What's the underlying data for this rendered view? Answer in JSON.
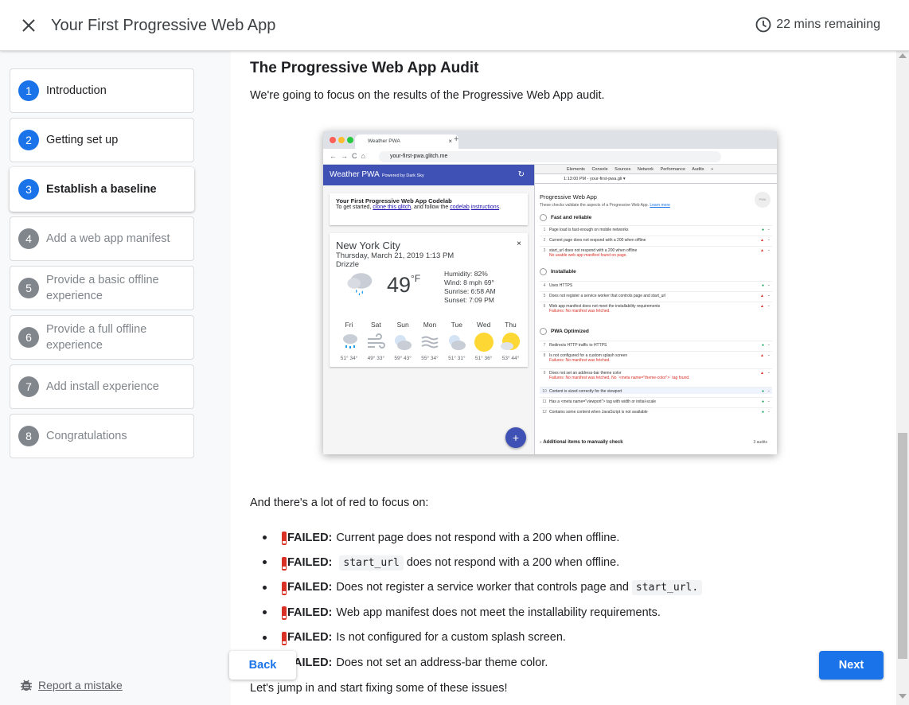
{
  "header": {
    "title": "Your First Progressive Web App",
    "time_remaining": "22 mins remaining"
  },
  "sidebar": {
    "steps": [
      {
        "num": "1",
        "label": "Introduction"
      },
      {
        "num": "2",
        "label": "Getting set up"
      },
      {
        "num": "3",
        "label": "Establish a baseline"
      },
      {
        "num": "4",
        "label": "Add a web app manifest"
      },
      {
        "num": "5",
        "label": "Provide a basic offline experience"
      },
      {
        "num": "6",
        "label": "Provide a full offline experience"
      },
      {
        "num": "7",
        "label": "Add install experience"
      },
      {
        "num": "8",
        "label": "Congratulations"
      }
    ],
    "current_step": 3,
    "report_label": "Report a mistake"
  },
  "content": {
    "title": "The Progressive Web App Audit",
    "intro": "We're going to focus on the results of the Progressive Web App audit.",
    "red_intro": "And there's a lot of red to focus on:",
    "failed_label": "FAILED:",
    "failures": [
      {
        "before": "Current page does not respond with a 200 when offline.",
        "code": "",
        "after": ""
      },
      {
        "before": "",
        "code": "start_url",
        "after": "does not respond with a 200 when offline."
      },
      {
        "before": "Does not register a service worker that controls page and",
        "code": "start_url.",
        "after": ""
      },
      {
        "before": "Web app manifest does not meet the installability requirements.",
        "code": "",
        "after": ""
      },
      {
        "before": "Is not configured for a custom splash screen.",
        "code": "",
        "after": ""
      },
      {
        "before": "Does not set an address-bar theme color.",
        "code": "",
        "after": ""
      }
    ],
    "outro": "Let's jump in and start fixing some of these issues!"
  },
  "screenshot": {
    "tab_title": "Weather PWA",
    "url": "your-first-pwa.glitch.me",
    "app_title": "Weather PWA",
    "powered_by": "Powered by Dark Sky",
    "codelab_title": "Your First Progressive Web App Codelab",
    "codelab_text_1": "To get started,",
    "codelab_link_1": "clone this glitch",
    "codelab_text_2": ", and follow the",
    "codelab_link_2": "codelab",
    "codelab_link_3": "instructions",
    "city": "New York City",
    "date": "Thursday, March 21, 2019 1:13 PM",
    "description": "Drizzle",
    "temperature": "49",
    "temp_unit": "°F",
    "humidity": "Humidity: 82%",
    "wind": "Wind: 8 mph 69°",
    "sunrise": "Sunrise: 6:58 AM",
    "sunset": "Sunset: 7:09 PM",
    "forecast": [
      {
        "day": "Fri",
        "temps": "51° 34°",
        "icon": "rain-icon"
      },
      {
        "day": "Sat",
        "temps": "49° 33°",
        "icon": "wind-icon"
      },
      {
        "day": "Sun",
        "temps": "59° 43°",
        "icon": "partly-cloudy-night-icon"
      },
      {
        "day": "Mon",
        "temps": "55° 34°",
        "icon": "fog-icon"
      },
      {
        "day": "Tue",
        "temps": "51° 31°",
        "icon": "partly-cloudy-night-icon"
      },
      {
        "day": "Wed",
        "temps": "51° 36°",
        "icon": "sun-icon"
      },
      {
        "day": "Thu",
        "temps": "53° 44°",
        "icon": "partly-cloudy-day-icon"
      }
    ],
    "devtools_tabs": "Elements Console Sources Network Performance Audits »",
    "devtools_sub": "1:13:00 PM - your-first-pwa.gli ▾",
    "audit_title": "Progressive Web App",
    "audit_subtitle": "These checks validate the aspects of a Progressive Web App.",
    "audit_learn_more": "Learn more",
    "badge": "PWA",
    "groups": [
      {
        "name": "Fast and reliable",
        "rows": [
          {
            "n": "1",
            "text": "Page load is fast enough on mobile networks",
            "status": "pass",
            "fail": ""
          },
          {
            "n": "2",
            "text": "Current page does not respond with a 200 when offline",
            "status": "fail",
            "fail": ""
          },
          {
            "n": "3",
            "text": "start_url does not respond with a 200 when offline",
            "status": "fail",
            "fail": "No usable web app manifest found on page."
          }
        ]
      },
      {
        "name": "Installable",
        "rows": [
          {
            "n": "4",
            "text": "Uses HTTPS",
            "status": "pass",
            "fail": ""
          },
          {
            "n": "5",
            "text": "Does not register a service worker that controls page and start_url",
            "status": "fail",
            "fail": ""
          },
          {
            "n": "6",
            "text": "Web app manifest does not meet the installability requirements",
            "status": "fail",
            "fail": "Failures: No manifest was fetched."
          }
        ]
      },
      {
        "name": "PWA Optimized",
        "rows": [
          {
            "n": "7",
            "text": "Redirects HTTP traffic to HTTPS",
            "status": "pass",
            "fail": ""
          },
          {
            "n": "8",
            "text": "Is not configured for a custom splash screen",
            "status": "fail",
            "fail": "Failures: No manifest was fetched."
          },
          {
            "n": "9",
            "text": "Does not set an address-bar theme color",
            "status": "fail",
            "fail": "Failures: No manifest was fetched, No `<meta name=\"theme-color\">` tag found."
          },
          {
            "n": "10",
            "text": "Content is sized correctly for the viewport",
            "status": "pass",
            "fail": ""
          },
          {
            "n": "11",
            "text": "Has a <meta name=\"viewport\"> tag with width or initial-scale",
            "status": "pass",
            "fail": ""
          },
          {
            "n": "12",
            "text": "Contains some content when JavaScript is not available",
            "status": "pass",
            "fail": ""
          }
        ]
      }
    ],
    "manual_label": "Additional items to manually check",
    "manual_count": "3 audits"
  },
  "buttons": {
    "back": "Back",
    "next": "Next"
  },
  "colors": {
    "accent": "#1a73e8",
    "fail": "#d93025",
    "pass": "#0f9d58",
    "pwa_bar": "#3f51b5"
  }
}
